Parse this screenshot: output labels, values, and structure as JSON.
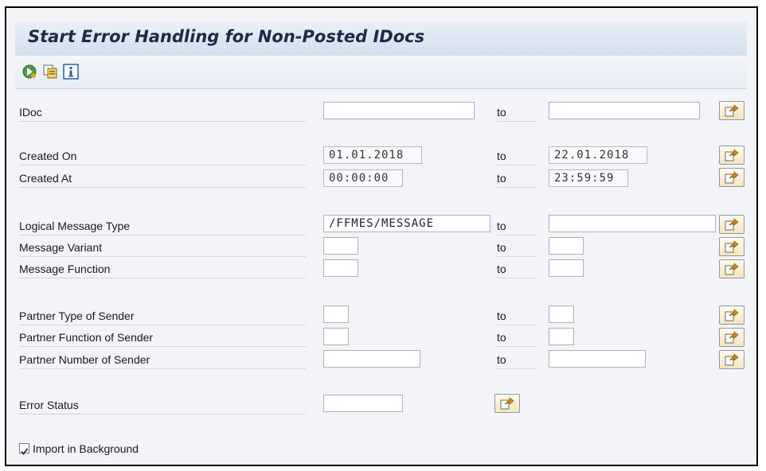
{
  "window": {
    "title": "Start Error Handling for Non-Posted IDocs"
  },
  "toolbar": {
    "icons": [
      "execute-icon",
      "copy-variant-icon",
      "info-icon"
    ]
  },
  "to_label": "to",
  "rows": {
    "idoc": {
      "label": "IDoc",
      "from": "",
      "to": ""
    },
    "created_on": {
      "label": "Created On",
      "from": "01.01.2018",
      "to": "22.01.2018"
    },
    "created_at": {
      "label": "Created At",
      "from": "00:00:00",
      "to": "23:59:59"
    },
    "logical_message_type": {
      "label": "Logical Message Type",
      "from": "/FFMES/MESSAGE",
      "to": ""
    },
    "message_variant": {
      "label": "Message Variant",
      "from": "",
      "to": ""
    },
    "message_function": {
      "label": "Message Function",
      "from": "",
      "to": ""
    },
    "partner_type_sender": {
      "label": "Partner Type of Sender",
      "from": "",
      "to": ""
    },
    "partner_function_sender": {
      "label": "Partner Function of Sender",
      "from": "",
      "to": ""
    },
    "partner_number_sender": {
      "label": "Partner Number of Sender",
      "from": "",
      "to": ""
    },
    "error_status": {
      "label": "Error Status",
      "value": ""
    }
  },
  "options": {
    "import_in_background": {
      "label": "Import in Background",
      "checked": true
    }
  },
  "colors": {
    "title_text": "#1c2c44",
    "multi_select_button": "#f4e6b8",
    "arrow": "#d08a00"
  }
}
